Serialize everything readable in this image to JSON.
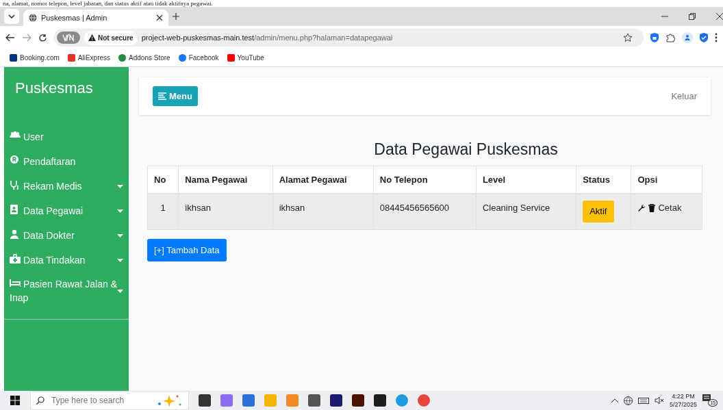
{
  "document_caption": "na, alamat, nomor telepon, level jabatan, dan status aktif atau tidak aktifnya pegawai.",
  "browser": {
    "tab_title": "Puskesmas | Admin",
    "security_label": "Not secure",
    "url_host": "project-web-puskesmas-main.test",
    "url_path": "/admin/menu.php?halaman=datapegawai",
    "bookmarks": [
      {
        "label": "Booking.com",
        "color": "#003580"
      },
      {
        "label": "AliExpress",
        "color": "#e43225"
      },
      {
        "label": "Addons Store",
        "color": "#1e8e3e"
      },
      {
        "label": "Facebook",
        "color": "#1877f2"
      },
      {
        "label": "YouTube",
        "color": "#ff0000"
      }
    ]
  },
  "app": {
    "brand": "Puskesmas",
    "sidebar": {
      "items": [
        {
          "label": "User",
          "has_submenu": false
        },
        {
          "label": "Pendaftaran",
          "has_submenu": false
        },
        {
          "label": "Rekam Medis",
          "has_submenu": true
        },
        {
          "label": "Data Pegawai",
          "has_submenu": true
        },
        {
          "label": "Data Dokter",
          "has_submenu": true
        },
        {
          "label": "Data Tindakan",
          "has_submenu": true
        },
        {
          "label": "Pasien Rawat Jalan & Inap",
          "has_submenu": true
        }
      ]
    },
    "menu_button": "Menu",
    "logout": "Keluar",
    "title": "Data Pegawai Puskesmas",
    "table": {
      "columns": [
        "No",
        "Nama Pegawai",
        "Alamat Pegawai",
        "No Telepon",
        "Level",
        "Status",
        "Opsi"
      ],
      "rows": [
        {
          "no": "1",
          "name": "ikhsan",
          "address": "ikhsan",
          "phone": "08445456565600",
          "level": "Cleaning Service",
          "status": "Aktif",
          "print": "Cetak"
        }
      ]
    },
    "add_button": "[+] Tambah Data"
  },
  "taskbar": {
    "search_placeholder": "Type here to search",
    "time": "4:22 PM",
    "date": "5/27/2025",
    "notification_count": "15"
  }
}
